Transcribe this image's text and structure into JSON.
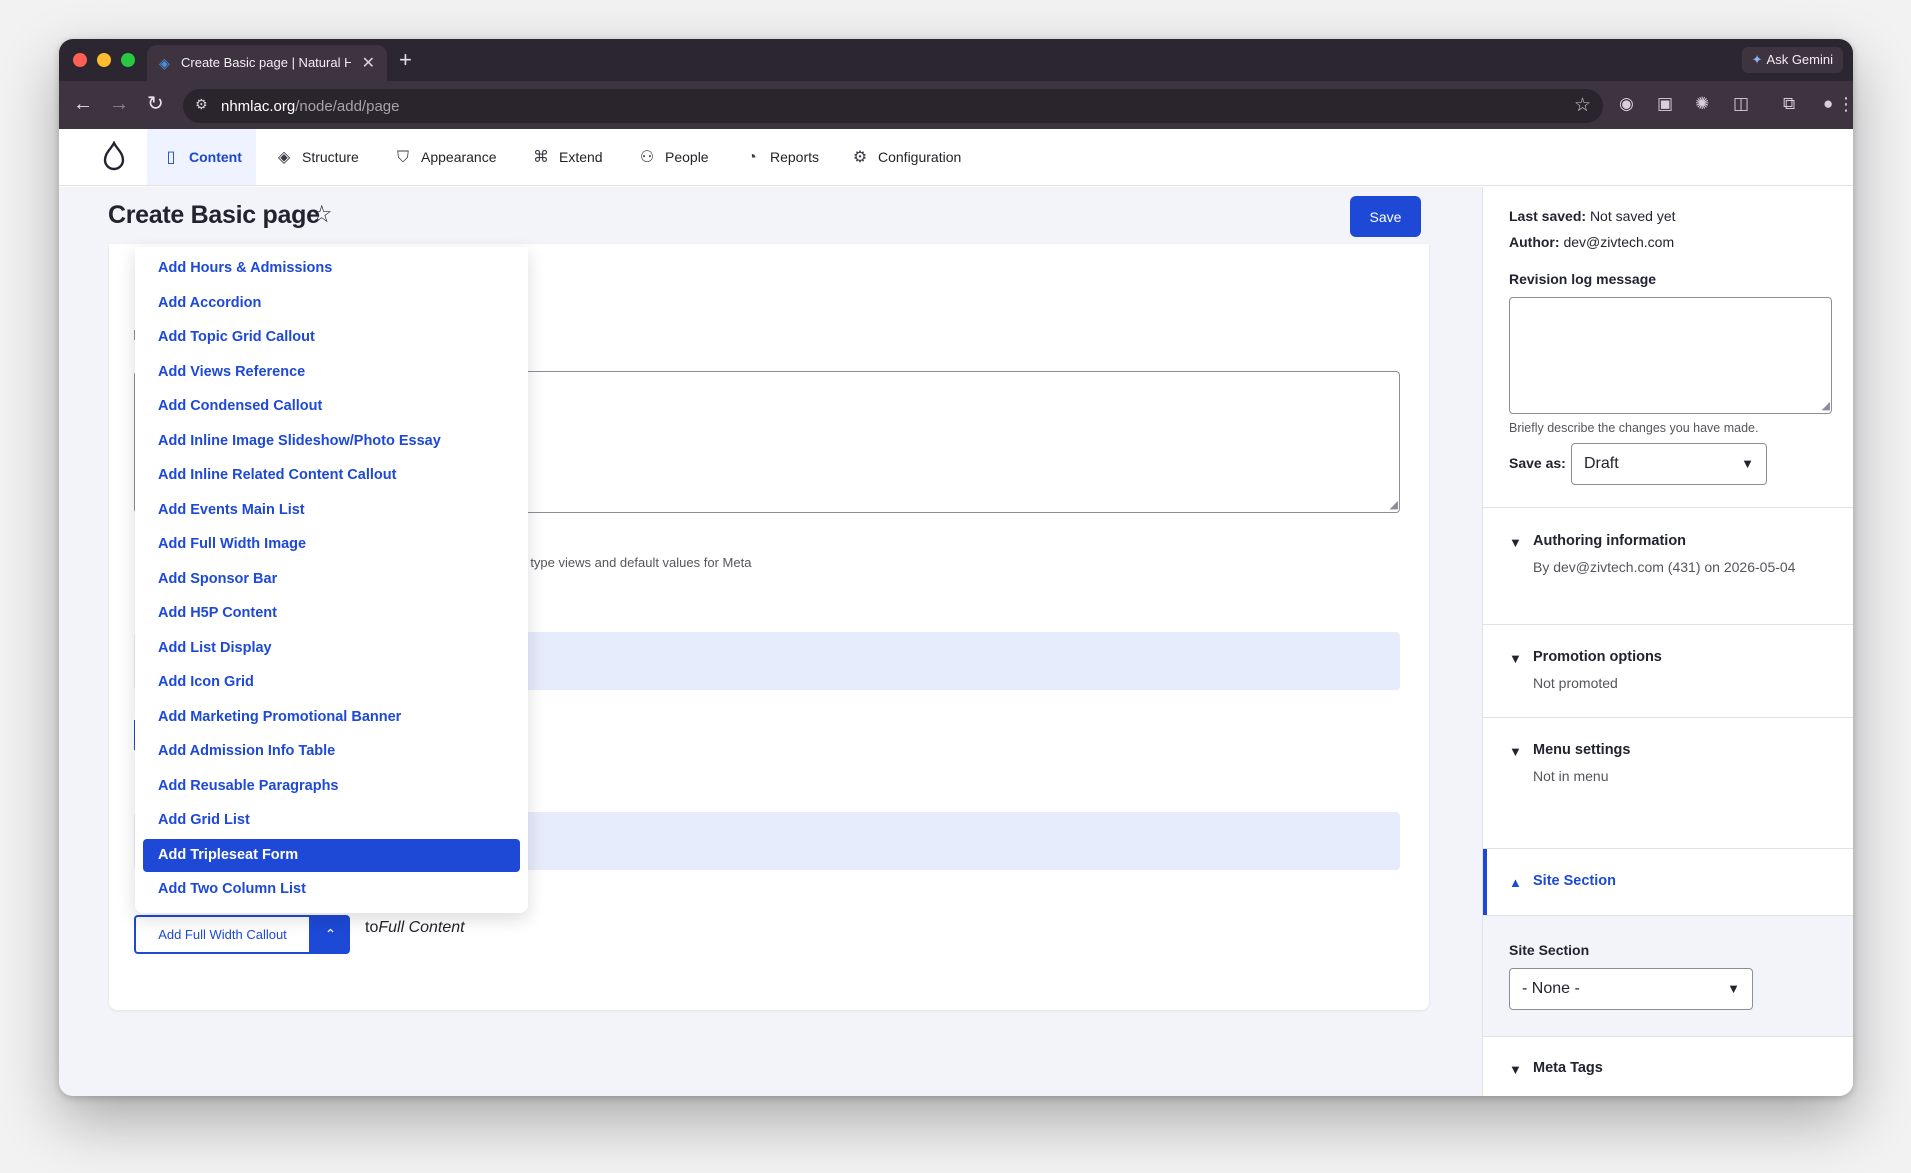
{
  "browser": {
    "tab_title": "Create Basic page | Natural H",
    "tab_close": "✕",
    "new_tab": "+",
    "ask_gemini": "Ask Gemini",
    "url_host": "nhmlac.org",
    "url_path": "/node/add/page"
  },
  "toolbar": {
    "items": [
      {
        "label": "Content",
        "icon": "document-icon"
      },
      {
        "label": "Structure",
        "icon": "layers-icon"
      },
      {
        "label": "Appearance",
        "icon": "brush-icon"
      },
      {
        "label": "Extend",
        "icon": "puzzle-icon"
      },
      {
        "label": "People",
        "icon": "people-icon"
      },
      {
        "label": "Reports",
        "icon": "chart-icon"
      },
      {
        "label": "Configuration",
        "icon": "gear-icon"
      }
    ]
  },
  "page": {
    "title": "Create Basic page",
    "save_label": "Save",
    "teaser_help_fragment": "g in teaser type views and default values for Meta"
  },
  "paragraph_dropdown": {
    "items": [
      "Add Hours & Admissions",
      "Add Accordion",
      "Add Topic Grid Callout",
      "Add Views Reference",
      "Add Condensed Callout",
      "Add Inline Image Slideshow/Photo Essay",
      "Add Inline Related Content Callout",
      "Add Events Main List",
      "Add Full Width Image",
      "Add Sponsor Bar",
      "Add H5P Content",
      "Add List Display",
      "Add Icon Grid",
      "Add Marketing Promotional Banner",
      "Add Admission Info Table",
      "Add Reusable Paragraphs",
      "Add Grid List",
      "Add Tripleseat Form",
      "Add Two Column List"
    ],
    "selected": "Add Tripleseat Form",
    "button_label": "Add Full Width Callout",
    "to_prefix": "to",
    "to_target": "Full Content"
  },
  "sidebar": {
    "last_saved_label": "Last saved:",
    "last_saved_value": "Not saved yet",
    "author_label": "Author:",
    "author_value": "dev@zivtech.com",
    "revision_label": "Revision log message",
    "revision_help": "Briefly describe the changes you have made.",
    "save_as_label": "Save as:",
    "save_as_value": "Draft",
    "authoring_title": "Authoring information",
    "authoring_summary": "By dev@zivtech.com (431) on 2026-05-04",
    "promotion_title": "Promotion options",
    "promotion_summary": "Not promoted",
    "menu_title": "Menu settings",
    "menu_summary": "Not in menu",
    "site_section_title": "Site Section",
    "site_section_label": "Site Section",
    "site_section_value": "- None -",
    "meta_tags_title": "Meta Tags"
  },
  "colors": {
    "accent": "#1d49d6",
    "accent_light": "#e6ecfc",
    "chrome_dark": "#2c2630"
  }
}
